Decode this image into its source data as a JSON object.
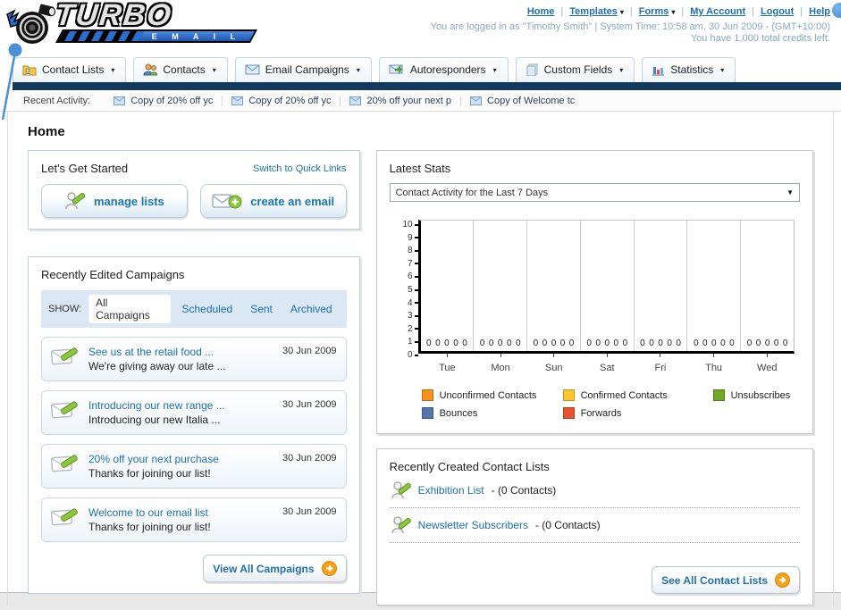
{
  "icons": {
    "chevron_down": "▾",
    "select_arrow": "▼"
  },
  "header": {
    "separator": "|",
    "logo": {
      "title": "TURBO",
      "subtitle": "E M A I L"
    },
    "top_links": [
      {
        "label": "Home",
        "dropdown": false
      },
      {
        "label": "Templates",
        "dropdown": true
      },
      {
        "label": "Forms",
        "dropdown": true
      },
      {
        "label": "My Account",
        "dropdown": false
      },
      {
        "label": "Logout",
        "dropdown": false
      },
      {
        "label": "Help",
        "dropdown": false
      }
    ],
    "login_line": "You are logged in as \"Timothy Smith\" | System Time: 10:58 am, 30 Jun 2009 - (GMT+10:00)",
    "credits_line": "You have 1,000 total credits left."
  },
  "nav": {
    "tabs": [
      {
        "label": "Contact Lists"
      },
      {
        "label": "Contacts"
      },
      {
        "label": "Email Campaigns"
      },
      {
        "label": "Autoresponders"
      },
      {
        "label": "Custom Fields"
      },
      {
        "label": "Statistics"
      }
    ]
  },
  "recent_activity": {
    "label": "Recent Activity:",
    "items": [
      "Copy of 20% off yc",
      "Copy of 20% off yc",
      "20% off your next p",
      "Copy of Welcome tc"
    ]
  },
  "page": {
    "title": "Home"
  },
  "get_started": {
    "title": "Let's Get Started",
    "switch_link": "Switch to Quick Links",
    "buttons": [
      {
        "label": "manage lists"
      },
      {
        "label": "create an email"
      }
    ]
  },
  "campaigns": {
    "title": "Recently Edited Campaigns",
    "show_label": "SHOW:",
    "filters": [
      "All Campaigns",
      "Scheduled",
      "Sent",
      "Archived"
    ],
    "active_filter": "All Campaigns",
    "items": [
      {
        "title": "See us at the retail food ...",
        "subtitle": "We're giving away our late ...",
        "date": "30 Jun 2009"
      },
      {
        "title": "Introducing our new range ...",
        "subtitle": "Introducing our new Italia ...",
        "date": "30 Jun 2009"
      },
      {
        "title": "20% off your next purchase",
        "subtitle": "Thanks for joining our list!",
        "date": "30 Jun 2009"
      },
      {
        "title": "Welcome to our email list",
        "subtitle": "Thanks for joining our list!",
        "date": "30 Jun 2009"
      }
    ],
    "view_all_label": "View All Campaigns"
  },
  "stats": {
    "title": "Latest Stats",
    "dropdown_value": "Contact Activity for the Last 7 Days"
  },
  "chart_data": {
    "type": "bar",
    "title": "Contact Activity for the Last 7 Days",
    "categories": [
      "Tue",
      "Mon",
      "Sun",
      "Sat",
      "Fri",
      "Thu",
      "Wed"
    ],
    "series": [
      {
        "name": "Unconfirmed Contacts",
        "color": "#f5921e",
        "values": [
          0,
          0,
          0,
          0,
          0,
          0,
          0
        ]
      },
      {
        "name": "Confirmed Contacts",
        "color": "#fdc62a",
        "values": [
          0,
          0,
          0,
          0,
          0,
          0,
          0
        ]
      },
      {
        "name": "Unsubscribes",
        "color": "#6fa822",
        "values": [
          0,
          0,
          0,
          0,
          0,
          0,
          0
        ]
      },
      {
        "name": "Bounces",
        "color": "#5573ae",
        "values": [
          0,
          0,
          0,
          0,
          0,
          0,
          0
        ]
      },
      {
        "name": "Forwards",
        "color": "#e8542e",
        "values": [
          0,
          0,
          0,
          0,
          0,
          0,
          0
        ]
      }
    ],
    "xlabel": "",
    "ylabel": "",
    "ylim": [
      0,
      10
    ],
    "grid": "vertical",
    "legend_position": "bottom"
  },
  "contact_lists": {
    "title": "Recently Created Contact Lists",
    "items": [
      {
        "name": "Exhibition List",
        "detail": "- (0 Contacts)"
      },
      {
        "name": "Newsletter Subscribers",
        "detail": "- (0 Contacts)"
      }
    ],
    "see_all_label": "See All Contact Lists"
  }
}
